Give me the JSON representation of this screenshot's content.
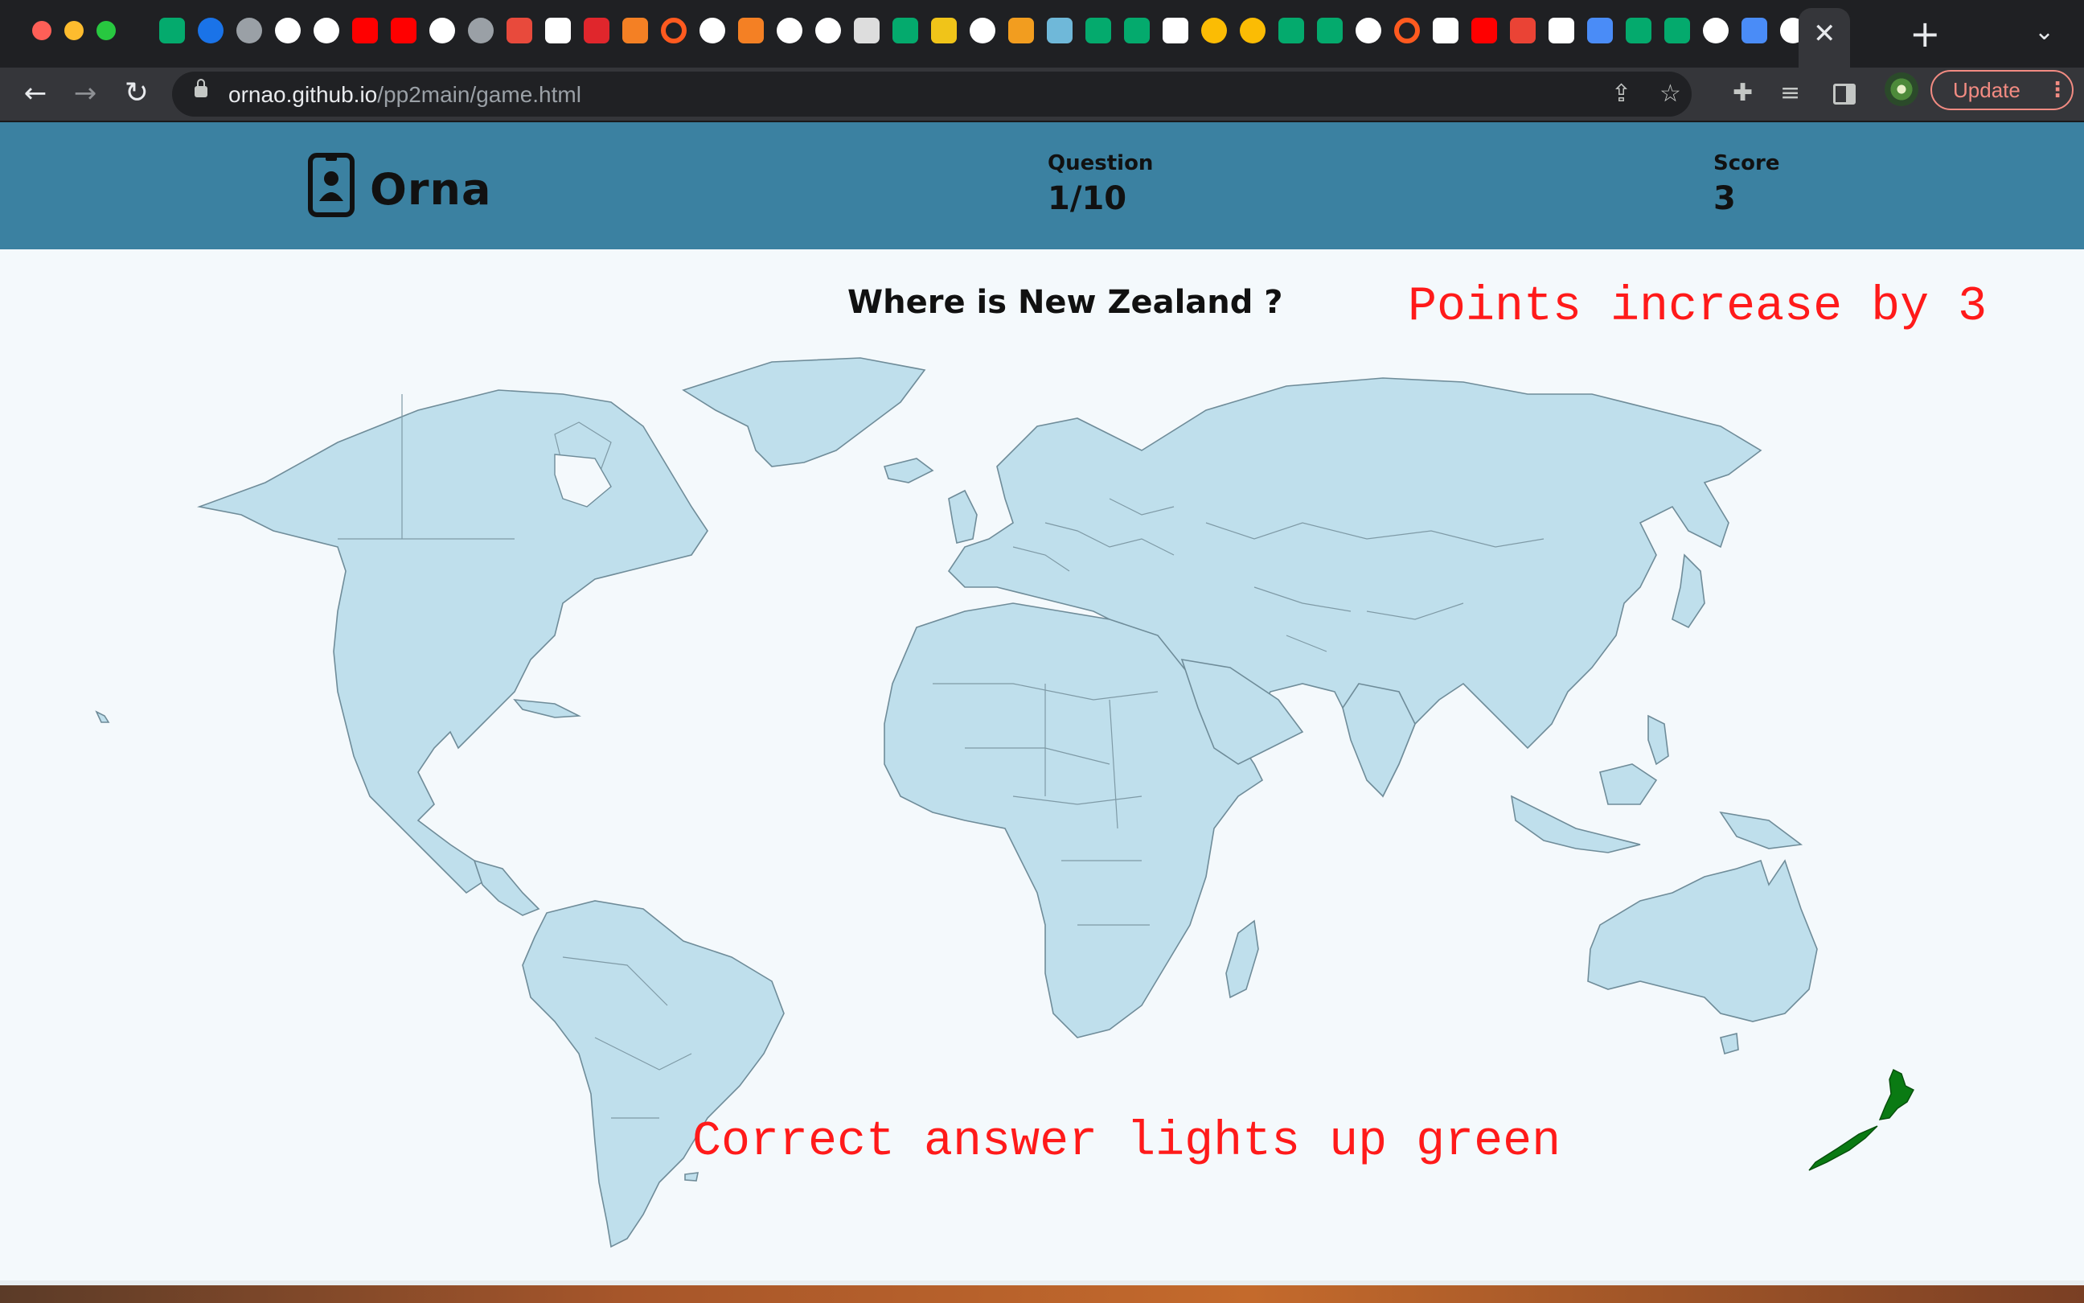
{
  "browser": {
    "url_host": "ornao.github.io",
    "url_path": "/pp2main/game.html",
    "update_label": "Update",
    "tab_favicons": [
      {
        "name": "w3schools-icon",
        "color": "#04aa6d"
      },
      {
        "name": "globe-icon",
        "color": "#1a73e8"
      },
      {
        "name": "globe-icon",
        "color": "#9aa0a6"
      },
      {
        "name": "github-icon",
        "color": "#ffffff"
      },
      {
        "name": "github-icon",
        "color": "#ffffff"
      },
      {
        "name": "youtube-icon",
        "color": "#ff0000"
      },
      {
        "name": "youtube-icon",
        "color": "#ff0000"
      },
      {
        "name": "google-icon",
        "color": "#ffffff"
      },
      {
        "name": "globe-icon",
        "color": "#9aa0a6"
      },
      {
        "name": "pencil-icon",
        "color": "#e84a3c"
      },
      {
        "name": "codepen-icon",
        "color": "#ffffff"
      },
      {
        "name": "p-icon",
        "color": "#e0262c"
      },
      {
        "name": "stackoverflow-icon",
        "color": "#f48024"
      },
      {
        "name": "ring-icon",
        "color": "#ff5a1f"
      },
      {
        "name": "google-icon",
        "color": "#ffffff"
      },
      {
        "name": "stackoverflow-icon",
        "color": "#f48024"
      },
      {
        "name": "google-icon",
        "color": "#ffffff"
      },
      {
        "name": "google-icon",
        "color": "#ffffff"
      },
      {
        "name": "m-icon",
        "color": "#dddddd"
      },
      {
        "name": "w3schools-icon",
        "color": "#04aa6d"
      },
      {
        "name": "linux-icon",
        "color": "#f0c419"
      },
      {
        "name": "chrome-icon",
        "color": "#ffffff"
      },
      {
        "name": "g-orange-icon",
        "color": "#f29d1f"
      },
      {
        "name": "map-icon",
        "color": "#6fb8d9"
      },
      {
        "name": "w3schools-icon",
        "color": "#04aa6d"
      },
      {
        "name": "w3schools-icon",
        "color": "#04aa6d"
      },
      {
        "name": "medium-icon",
        "color": "#ffffff"
      },
      {
        "name": "chrome-colour-icon",
        "color": "#fbbc04"
      },
      {
        "name": "chrome-colour-icon",
        "color": "#fbbc04"
      },
      {
        "name": "w3schools-icon",
        "color": "#04aa6d"
      },
      {
        "name": "w3schools-icon",
        "color": "#04aa6d"
      },
      {
        "name": "google-icon",
        "color": "#ffffff"
      },
      {
        "name": "ring-icon",
        "color": "#ff5a1f"
      },
      {
        "name": "medium-icon",
        "color": "#ffffff"
      },
      {
        "name": "youtube-icon",
        "color": "#ff0000"
      },
      {
        "name": "gmail-icon",
        "color": "#ea4335"
      },
      {
        "name": "t-icon",
        "color": "#ffffff"
      },
      {
        "name": "flag-icon",
        "color": "#4a8cf7"
      },
      {
        "name": "w3schools-icon",
        "color": "#04aa6d"
      },
      {
        "name": "w3schools-icon",
        "color": "#04aa6d"
      },
      {
        "name": "google-icon",
        "color": "#ffffff"
      },
      {
        "name": "flag-icon",
        "color": "#4a8cf7"
      },
      {
        "name": "github-icon",
        "color": "#ffffff"
      }
    ]
  },
  "header": {
    "brand": "Orna",
    "question_label": "Question",
    "question_value": "1/10",
    "score_label": "Score",
    "score_value": "3"
  },
  "game": {
    "prompt": "Where is New Zealand ?",
    "highlight_color": "#0a7a13",
    "land_color": "#bfdfec"
  },
  "annotations": {
    "points": "Points increase by 3",
    "correct": "Correct answer lights up green",
    "color": "#ff1a1a"
  }
}
